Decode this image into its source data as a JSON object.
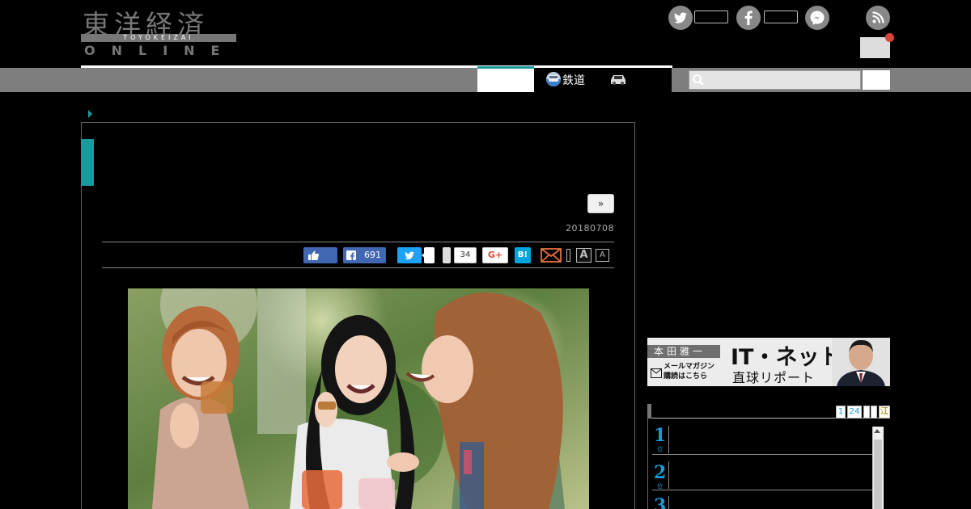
{
  "header": {
    "logo_kanji": "東洋経済",
    "logo_sub": "TOYOKEIZAI",
    "logo_online": "ONLINE"
  },
  "nav": {
    "rail_label": "鉄道"
  },
  "search": {
    "placeholder": ""
  },
  "article": {
    "more_label": "»",
    "date": "20180708",
    "share": {
      "fb_count": "691",
      "pocket_count": "34",
      "gplus_label": "G+",
      "hatena_label": "B!",
      "font_large": "A",
      "font_small": "A"
    }
  },
  "sidebar": {
    "banner": {
      "author": "本田雅一",
      "mail_line1": "メールマガジン",
      "mail_line2": "購読はこちら",
      "title": "IT・ネット",
      "subtitle": "直球リポート"
    },
    "ranking": {
      "tabs": [
        "1",
        "24",
        "",
        "",
        "江"
      ],
      "items": [
        {
          "rank": "1",
          "unit": "位"
        },
        {
          "rank": "2",
          "unit": "位"
        },
        {
          "rank": "3",
          "unit": "位"
        }
      ]
    }
  },
  "colors": {
    "accent_teal": "#1a9a9e",
    "facebook": "#4267b2",
    "twitter": "#1da1f2",
    "hatena": "#00a4de",
    "ranking_blue": "#1a9ad6",
    "notification": "#d9453a"
  }
}
